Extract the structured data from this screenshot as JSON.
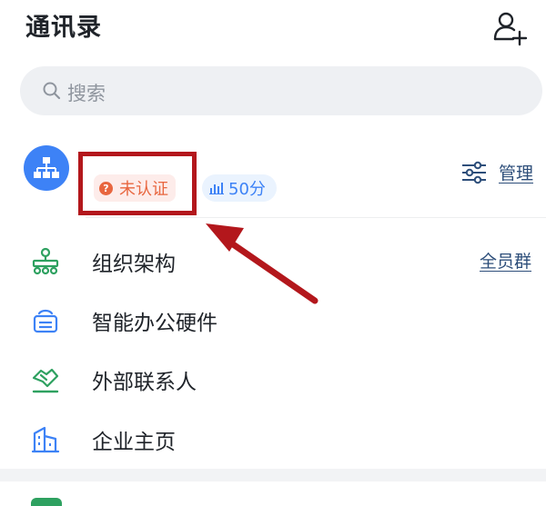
{
  "header": {
    "title": "通讯录",
    "add_contact_icon": "add-contact-icon"
  },
  "search": {
    "placeholder": "搜索",
    "icon": "search-icon"
  },
  "org": {
    "avatar_icon": "org-tree-icon",
    "verification_status": "未认证",
    "score": "50分",
    "manage_label": "管理"
  },
  "menu": [
    {
      "label": "组织架构",
      "icon": "org-chart-icon"
    },
    {
      "label": "智能办公硬件",
      "icon": "office-hardware-icon"
    },
    {
      "label": "外部联系人",
      "icon": "handshake-icon"
    },
    {
      "label": "企业主页",
      "icon": "building-icon"
    }
  ],
  "all_group_label": "全员群",
  "colors": {
    "accent_blue": "#3d82f6",
    "accent_green": "#2ea160",
    "warning_orange": "#e8663f",
    "annotation_red": "#b3171c",
    "link_navy": "#2d4e7a"
  }
}
